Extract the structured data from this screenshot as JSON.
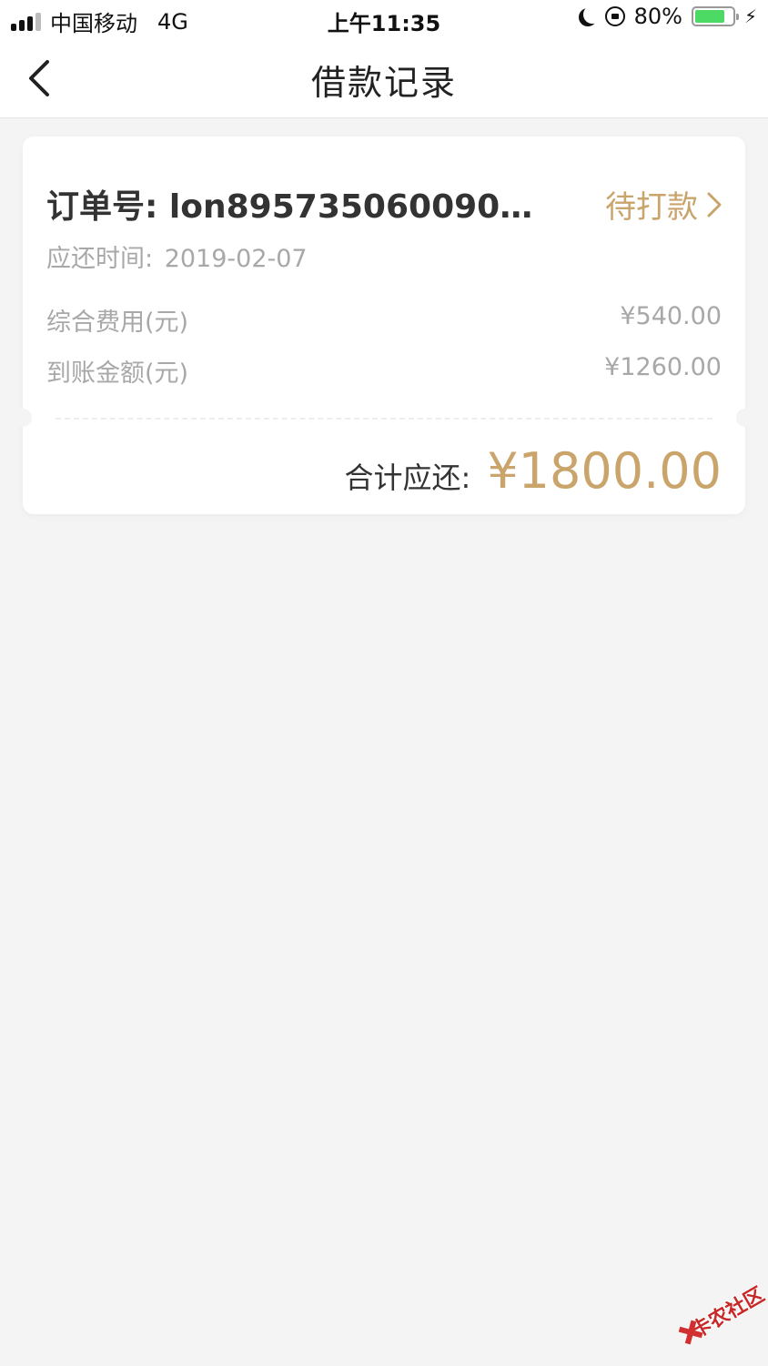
{
  "status_bar": {
    "carrier": "中国移动",
    "network": "4G",
    "time": "上午11:35",
    "battery_percent": "80%",
    "battery_level": 0.8,
    "signal_bars": 3
  },
  "nav": {
    "title": "借款记录",
    "back_icon": "chevron-left-icon"
  },
  "order": {
    "order_number": "订单号: lon895735060090…",
    "status": "待打款",
    "due_label": "应还时间:",
    "due_date": "2019-02-07",
    "fees": [
      {
        "label": "综合费用(元)",
        "value": "¥540.00"
      },
      {
        "label": "到账金额(元)",
        "value": "¥1260.00"
      }
    ],
    "total_label": "合计应还:",
    "total_value": "¥1800.00"
  },
  "watermark": {
    "text": "卡农社区"
  },
  "colors": {
    "accent_gold": "#c9a46b",
    "background": "#f4f4f4",
    "battery_green": "#4cd964"
  }
}
